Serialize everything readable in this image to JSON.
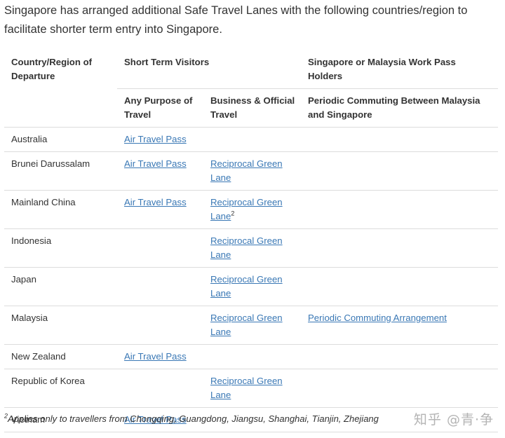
{
  "intro": {
    "text": "Singapore has arranged additional Safe Travel Lanes with the following countries/region to facilitate shorter term entry into Singapore."
  },
  "table": {
    "header": {
      "country": "Country/Region of Departure",
      "short_term": "Short Term Visitors",
      "work_pass": "Singapore or Malaysia Work Pass Holders",
      "any_purpose": "Any Purpose of Travel",
      "business": "Business & Official Travel",
      "periodic": "Periodic Commuting Between Malaysia and Singapore"
    },
    "rows": [
      {
        "country": "Australia",
        "any_purpose": "Air Travel Pass",
        "business": "",
        "business_sup": "",
        "periodic": ""
      },
      {
        "country": "Brunei Darussalam",
        "any_purpose": "Air Travel Pass",
        "business": "Reciprocal Green Lane",
        "business_sup": "",
        "periodic": ""
      },
      {
        "country": "Mainland China",
        "any_purpose": "Air Travel Pass",
        "business": "Reciprocal Green Lane",
        "business_sup": "2",
        "periodic": ""
      },
      {
        "country": "Indonesia",
        "any_purpose": "",
        "business": "Reciprocal Green Lane",
        "business_sup": "",
        "periodic": ""
      },
      {
        "country": "Japan",
        "any_purpose": "",
        "business": "Reciprocal Green Lane",
        "business_sup": "",
        "periodic": ""
      },
      {
        "country": "Malaysia",
        "any_purpose": "",
        "business": "Reciprocal Green Lane",
        "business_sup": "",
        "periodic": "Periodic Commuting Arrangement"
      },
      {
        "country": "New Zealand",
        "any_purpose": "Air Travel Pass",
        "business": "",
        "business_sup": "",
        "periodic": ""
      },
      {
        "country": "Republic of Korea",
        "any_purpose": "",
        "business": "Reciprocal Green Lane",
        "business_sup": "",
        "periodic": ""
      },
      {
        "country": "Vietnam",
        "any_purpose": "Air Travel Pass",
        "business": "",
        "business_sup": "",
        "periodic": ""
      }
    ]
  },
  "footnote": {
    "marker": "2",
    "text": "Applies only to travellers from Chongqing, Guangdong, Jiangsu, Shanghai, Tianjin, Zhejiang"
  },
  "watermark": {
    "text": "知乎 @青·争"
  },
  "colors": {
    "link": "#3a78b5",
    "text": "#333333",
    "border": "#dcdcdc"
  }
}
